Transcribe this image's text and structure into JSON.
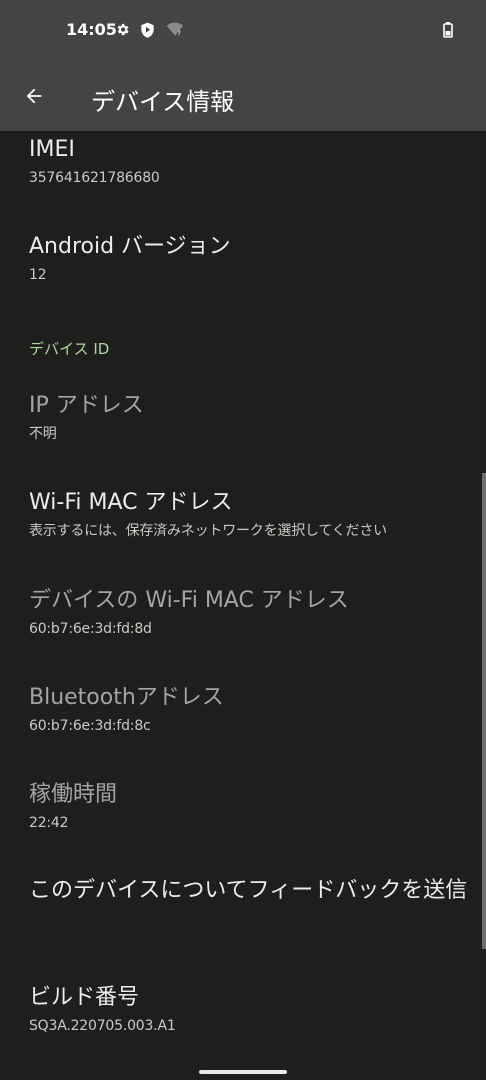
{
  "status_bar": {
    "time": "14:05",
    "icons": [
      "gear-icon",
      "shield-play-icon",
      "wifi-unknown-icon",
      "battery-icon"
    ]
  },
  "app_bar": {
    "back_icon": "arrow-back-icon",
    "title": "デバイス情報"
  },
  "preferences": [
    {
      "title": "IMEI",
      "summary": "357641621786680",
      "enabled": true
    },
    {
      "title": "Android バージョン",
      "summary": "12",
      "enabled": true
    }
  ],
  "section": {
    "header": "デバイス ID"
  },
  "id_preferences": [
    {
      "title": "IP アドレス",
      "summary": "不明",
      "enabled": false
    },
    {
      "title": "Wi-Fi MAC アドレス",
      "summary": "表示するには、保存済みネットワークを選択してください",
      "enabled": true
    },
    {
      "title": "デバイスの Wi-Fi MAC アドレス",
      "summary": "60:b7:6e:3d:fd:8d",
      "enabled": false
    },
    {
      "title": "Bluetoothアドレス",
      "summary": "60:b7:6e:3d:fd:8c",
      "enabled": false
    },
    {
      "title": "稼働時間",
      "summary": "22:42",
      "enabled": false
    },
    {
      "title": "このデバイスについてフィードバックを送信",
      "enabled": true
    },
    {
      "title": "ビルド番号",
      "summary": "SQ3A.220705.003.A1",
      "enabled": true
    }
  ],
  "colors": {
    "background": "#1e1f1d",
    "app_bar": "#444542",
    "section_header": "#a8d89b",
    "text_primary": "#ececea",
    "text_disabled": "#a4a5a2"
  }
}
